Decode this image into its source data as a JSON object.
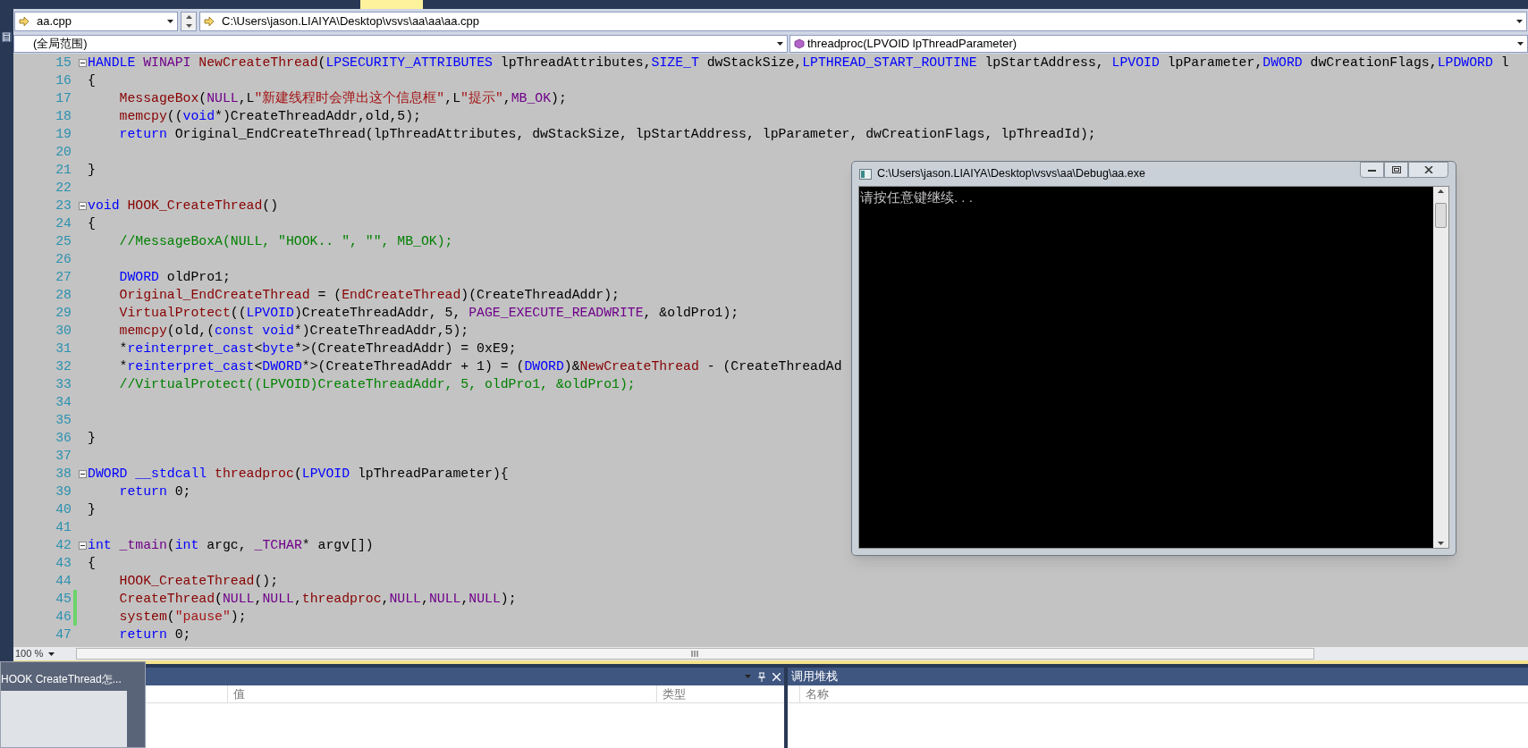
{
  "side_tab": "目",
  "navigation": {
    "file": "aa.cpp",
    "path": "C:\\Users\\jason.LIAIYA\\Desktop\\vsvs\\aa\\aa\\aa.cpp",
    "scope": "(全局范围)",
    "member": "threadproc(LPVOID lpThreadParameter)"
  },
  "editor": {
    "zoom": "100 %",
    "lines": [
      {
        "number": "15",
        "foldable": true,
        "changed": false,
        "indented": false,
        "tokens": [
          {
            "kind": "keyword",
            "text": "HANDLE "
          },
          {
            "kind": "macro",
            "text": "WINAPI "
          },
          {
            "kind": "function",
            "text": "NewCreateThread"
          },
          {
            "kind": "plain",
            "text": "("
          },
          {
            "kind": "keyword",
            "text": "LPSECURITY_ATTRIBUTES"
          },
          {
            "kind": "plain",
            "text": " lpThreadAttributes,"
          },
          {
            "kind": "keyword",
            "text": "SIZE_T"
          },
          {
            "kind": "plain",
            "text": " dwStackSize,"
          },
          {
            "kind": "keyword",
            "text": "LPTHREAD_START_ROUTINE"
          },
          {
            "kind": "plain",
            "text": " lpStartAddress, "
          },
          {
            "kind": "keyword",
            "text": "LPVOID"
          },
          {
            "kind": "plain",
            "text": " lpParameter,"
          },
          {
            "kind": "keyword",
            "text": "DWORD"
          },
          {
            "kind": "plain",
            "text": " dwCreationFlags,"
          },
          {
            "kind": "keyword",
            "text": "LPDWORD"
          },
          {
            "kind": "plain",
            "text": " l"
          }
        ]
      },
      {
        "number": "16",
        "foldable": false,
        "changed": false,
        "indented": false,
        "tokens": [
          {
            "kind": "plain",
            "text": "{"
          }
        ]
      },
      {
        "number": "17",
        "foldable": false,
        "changed": false,
        "indented": true,
        "tokens": [
          {
            "kind": "function",
            "text": "MessageBox"
          },
          {
            "kind": "plain",
            "text": "("
          },
          {
            "kind": "macro",
            "text": "NULL"
          },
          {
            "kind": "plain",
            "text": ",L"
          },
          {
            "kind": "string",
            "text": "\"新建线程时会弹出这个信息框\""
          },
          {
            "kind": "plain",
            "text": ",L"
          },
          {
            "kind": "string",
            "text": "\"提示\""
          },
          {
            "kind": "plain",
            "text": ","
          },
          {
            "kind": "macro",
            "text": "MB_OK"
          },
          {
            "kind": "plain",
            "text": ");"
          }
        ]
      },
      {
        "number": "18",
        "foldable": false,
        "changed": false,
        "indented": true,
        "tokens": [
          {
            "kind": "function",
            "text": "memcpy"
          },
          {
            "kind": "plain",
            "text": "(("
          },
          {
            "kind": "keyword",
            "text": "void"
          },
          {
            "kind": "plain",
            "text": "*)CreateThreadAddr,old,5);"
          }
        ]
      },
      {
        "number": "19",
        "foldable": false,
        "changed": false,
        "indented": true,
        "tokens": [
          {
            "kind": "keyword",
            "text": "return"
          },
          {
            "kind": "plain",
            "text": " Original_EndCreateThread(lpThreadAttributes, dwStackSize, lpStartAddress, lpParameter, dwCreationFlags, lpThreadId);"
          }
        ]
      },
      {
        "number": "20",
        "foldable": false,
        "changed": false,
        "indented": false
      },
      {
        "number": "21",
        "foldable": false,
        "changed": false,
        "indented": false,
        "tokens": [
          {
            "kind": "plain",
            "text": "}"
          }
        ]
      },
      {
        "number": "22",
        "foldable": false,
        "changed": false,
        "indented": false
      },
      {
        "number": "23",
        "foldable": true,
        "changed": false,
        "indented": false,
        "tokens": [
          {
            "kind": "keyword",
            "text": "void "
          },
          {
            "kind": "function",
            "text": "HOOK_CreateThread"
          },
          {
            "kind": "plain",
            "text": "()"
          }
        ]
      },
      {
        "number": "24",
        "foldable": false,
        "changed": false,
        "indented": false,
        "tokens": [
          {
            "kind": "plain",
            "text": "{"
          }
        ]
      },
      {
        "number": "25",
        "foldable": false,
        "changed": false,
        "indented": true,
        "tokens": [
          {
            "kind": "comment",
            "text": "//MessageBoxA(NULL, \"HOOK.. \", \"\", MB_OK);"
          }
        ]
      },
      {
        "number": "26",
        "foldable": false,
        "changed": false,
        "indented": false
      },
      {
        "number": "27",
        "foldable": false,
        "changed": false,
        "indented": true,
        "tokens": [
          {
            "kind": "keyword",
            "text": "DWORD"
          },
          {
            "kind": "plain",
            "text": " oldPro1;"
          }
        ]
      },
      {
        "number": "28",
        "foldable": false,
        "changed": false,
        "indented": true,
        "tokens": [
          {
            "kind": "function",
            "text": "Original_EndCreateThread"
          },
          {
            "kind": "plain",
            "text": " = ("
          },
          {
            "kind": "function",
            "text": "EndCreateThread"
          },
          {
            "kind": "plain",
            "text": ")(CreateThreadAddr);"
          }
        ]
      },
      {
        "number": "29",
        "foldable": false,
        "changed": false,
        "indented": true,
        "tokens": [
          {
            "kind": "function",
            "text": "VirtualProtect"
          },
          {
            "kind": "plain",
            "text": "(("
          },
          {
            "kind": "keyword",
            "text": "LPVOID"
          },
          {
            "kind": "plain",
            "text": ")CreateThreadAddr, 5, "
          },
          {
            "kind": "macro",
            "text": "PAGE_EXECUTE_READWRITE"
          },
          {
            "kind": "plain",
            "text": ", &oldPro1);"
          }
        ]
      },
      {
        "number": "30",
        "foldable": false,
        "changed": false,
        "indented": true,
        "tokens": [
          {
            "kind": "function",
            "text": "memcpy"
          },
          {
            "kind": "plain",
            "text": "(old,("
          },
          {
            "kind": "keyword",
            "text": "const void"
          },
          {
            "kind": "plain",
            "text": "*)CreateThreadAddr,5);"
          }
        ]
      },
      {
        "number": "31",
        "foldable": false,
        "changed": false,
        "indented": true,
        "tokens": [
          {
            "kind": "plain",
            "text": "*"
          },
          {
            "kind": "keyword",
            "text": "reinterpret_cast"
          },
          {
            "kind": "plain",
            "text": "<"
          },
          {
            "kind": "keyword",
            "text": "byte"
          },
          {
            "kind": "plain",
            "text": "*>(CreateThreadAddr) = 0xE9;"
          }
        ]
      },
      {
        "number": "32",
        "foldable": false,
        "changed": false,
        "indented": true,
        "tokens": [
          {
            "kind": "plain",
            "text": "*"
          },
          {
            "kind": "keyword",
            "text": "reinterpret_cast"
          },
          {
            "kind": "plain",
            "text": "<"
          },
          {
            "kind": "keyword",
            "text": "DWORD"
          },
          {
            "kind": "plain",
            "text": "*>(CreateThreadAddr + 1) = ("
          },
          {
            "kind": "keyword",
            "text": "DWORD"
          },
          {
            "kind": "plain",
            "text": ")&"
          },
          {
            "kind": "function",
            "text": "NewCreateThread"
          },
          {
            "kind": "plain",
            "text": " - (CreateThreadAd"
          }
        ]
      },
      {
        "number": "33",
        "foldable": false,
        "changed": false,
        "indented": true,
        "tokens": [
          {
            "kind": "comment",
            "text": "//VirtualProtect((LPVOID)CreateThreadAddr, 5, oldPro1, &oldPro1);"
          }
        ]
      },
      {
        "number": "34",
        "foldable": false,
        "changed": false,
        "indented": false
      },
      {
        "number": "35",
        "foldable": false,
        "changed": false,
        "indented": false
      },
      {
        "number": "36",
        "foldable": false,
        "changed": false,
        "indented": false,
        "tokens": [
          {
            "kind": "plain",
            "text": "}"
          }
        ]
      },
      {
        "number": "37",
        "foldable": false,
        "changed": false,
        "indented": false
      },
      {
        "number": "38",
        "foldable": true,
        "changed": false,
        "indented": false,
        "tokens": [
          {
            "kind": "keyword",
            "text": "DWORD __stdcall "
          },
          {
            "kind": "function",
            "text": "threadproc"
          },
          {
            "kind": "plain",
            "text": "("
          },
          {
            "kind": "keyword",
            "text": "LPVOID"
          },
          {
            "kind": "plain",
            "text": " lpThreadParameter){"
          }
        ]
      },
      {
        "number": "39",
        "foldable": false,
        "changed": false,
        "indented": true,
        "tokens": [
          {
            "kind": "keyword",
            "text": "return"
          },
          {
            "kind": "plain",
            "text": " 0;"
          }
        ]
      },
      {
        "number": "40",
        "foldable": false,
        "changed": false,
        "indented": false,
        "tokens": [
          {
            "kind": "plain",
            "text": "}"
          }
        ]
      },
      {
        "number": "41",
        "foldable": false,
        "changed": false,
        "indented": false
      },
      {
        "number": "42",
        "foldable": true,
        "changed": false,
        "indented": false,
        "tokens": [
          {
            "kind": "keyword",
            "text": "int "
          },
          {
            "kind": "macro",
            "text": "_tmain"
          },
          {
            "kind": "plain",
            "text": "("
          },
          {
            "kind": "keyword",
            "text": "int"
          },
          {
            "kind": "plain",
            "text": " argc, "
          },
          {
            "kind": "macro",
            "text": "_TCHAR"
          },
          {
            "kind": "plain",
            "text": "* argv[])"
          }
        ]
      },
      {
        "number": "43",
        "foldable": false,
        "changed": false,
        "indented": false,
        "tokens": [
          {
            "kind": "plain",
            "text": "{"
          }
        ]
      },
      {
        "number": "44",
        "foldable": false,
        "changed": false,
        "indented": true,
        "tokens": [
          {
            "kind": "function",
            "text": "HOOK_CreateThread"
          },
          {
            "kind": "plain",
            "text": "();"
          }
        ]
      },
      {
        "number": "45",
        "foldable": false,
        "changed": true,
        "indented": true,
        "tokens": [
          {
            "kind": "function",
            "text": "CreateThread"
          },
          {
            "kind": "plain",
            "text": "("
          },
          {
            "kind": "macro",
            "text": "NULL"
          },
          {
            "kind": "plain",
            "text": ","
          },
          {
            "kind": "macro",
            "text": "NULL"
          },
          {
            "kind": "plain",
            "text": ","
          },
          {
            "kind": "function",
            "text": "threadproc"
          },
          {
            "kind": "plain",
            "text": ","
          },
          {
            "kind": "macro",
            "text": "NULL"
          },
          {
            "kind": "plain",
            "text": ","
          },
          {
            "kind": "macro",
            "text": "NULL"
          },
          {
            "kind": "plain",
            "text": ","
          },
          {
            "kind": "macro",
            "text": "NULL"
          },
          {
            "kind": "plain",
            "text": ");"
          }
        ]
      },
      {
        "number": "46",
        "foldable": false,
        "changed": true,
        "indented": true,
        "tokens": [
          {
            "kind": "function",
            "text": "system"
          },
          {
            "kind": "plain",
            "text": "("
          },
          {
            "kind": "string",
            "text": "\"pause\""
          },
          {
            "kind": "plain",
            "text": ");"
          }
        ]
      },
      {
        "number": "47",
        "foldable": false,
        "changed": false,
        "indented": true,
        "tokens": [
          {
            "kind": "keyword",
            "text": "return"
          },
          {
            "kind": "plain",
            "text": " 0;"
          }
        ]
      }
    ]
  },
  "console": {
    "title": "C:\\Users\\jason.LIAIYA\\Desktop\\vsvs\\aa\\Debug\\aa.exe",
    "output": "请按任意键继续. . ."
  },
  "locals_panel": {
    "columns": [
      "值",
      "类型"
    ]
  },
  "call_stack_panel": {
    "title": "调用堆栈",
    "columns": [
      "名称"
    ]
  },
  "taskbar_preview": {
    "title": "HOOK CreateThread怎..."
  }
}
